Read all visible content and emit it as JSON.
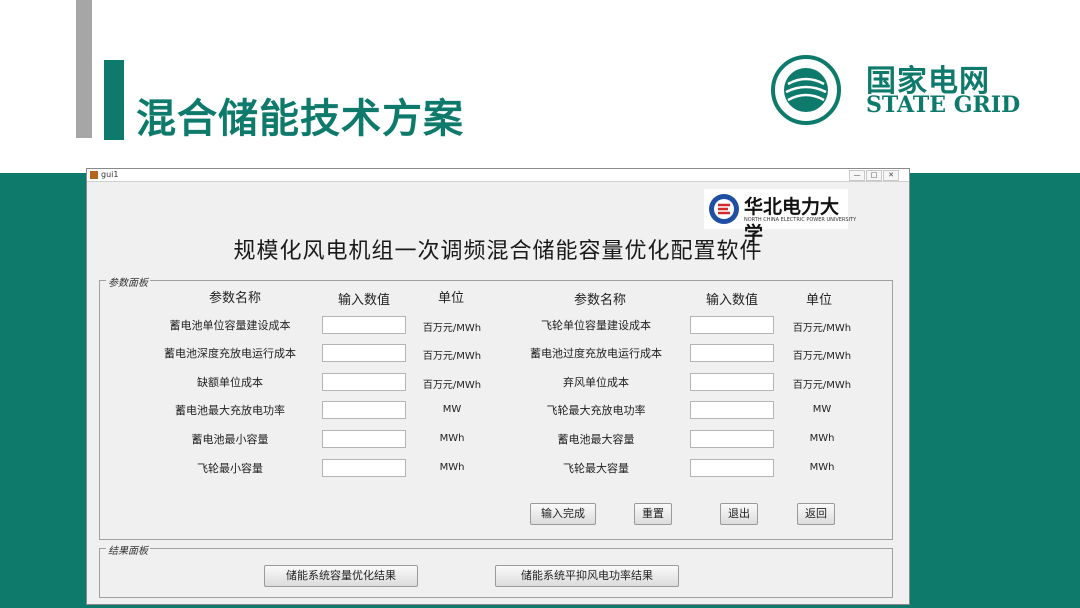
{
  "slide": {
    "title": "混合储能技术方案",
    "logo_cn": "国家电网",
    "logo_en": "STATE GRID",
    "colors": {
      "teal": "#0e7a6c",
      "gray": "#a6a6a6"
    }
  },
  "window": {
    "title": "gui1",
    "controls": {
      "minimize": "—",
      "maximize": "□",
      "close": "✕"
    }
  },
  "university": {
    "name": "华北电力大学",
    "name_en": "NORTH CHINA ELECTRIC POWER UNIVERSITY"
  },
  "app_title": "规模化风电机组一次调频混合储能容量优化配置软件",
  "param_panel": {
    "label": "参数面板",
    "headers": {
      "name": "参数名称",
      "value": "输入数值",
      "unit": "单位"
    },
    "left_rows": [
      {
        "label": "蓄电池单位容量建设成本",
        "unit": "百万元/MWh",
        "value": ""
      },
      {
        "label": "蓄电池深度充放电运行成本",
        "unit": "百万元/MWh",
        "value": ""
      },
      {
        "label": "缺额单位成本",
        "unit": "百万元/MWh",
        "value": ""
      },
      {
        "label": "蓄电池最大充放电功率",
        "unit": "MW",
        "value": ""
      },
      {
        "label": "蓄电池最小容量",
        "unit": "MWh",
        "value": ""
      },
      {
        "label": "飞轮最小容量",
        "unit": "MWh",
        "value": ""
      }
    ],
    "right_rows": [
      {
        "label": "飞轮单位容量建设成本",
        "unit": "百万元/MWh",
        "value": ""
      },
      {
        "label": "蓄电池过度充放电运行成本",
        "unit": "百万元/MWh",
        "value": ""
      },
      {
        "label": "弃风单位成本",
        "unit": "百万元/MWh",
        "value": ""
      },
      {
        "label": "飞轮最大充放电功率",
        "unit": "MW",
        "value": ""
      },
      {
        "label": "蓄电池最大容量",
        "unit": "MWh",
        "value": ""
      },
      {
        "label": "飞轮最大容量",
        "unit": "MWh",
        "value": ""
      }
    ],
    "buttons": {
      "done": "输入完成",
      "reset": "重置",
      "exit": "退出",
      "back": "返回"
    }
  },
  "result_panel": {
    "label": "结果面板",
    "buttons": {
      "capacity": "储能系统容量优化结果",
      "smoothing": "储能系统平抑风电功率结果"
    }
  }
}
